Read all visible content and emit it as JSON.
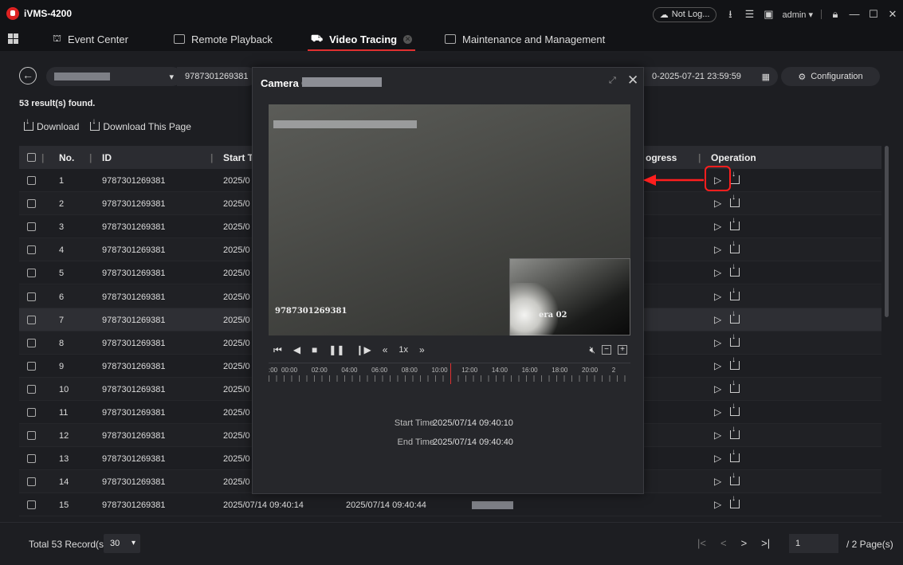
{
  "app": {
    "title": "iVMS-4200"
  },
  "titlebar": {
    "status": "Not Log...",
    "user": "admin"
  },
  "tabs": [
    {
      "label": "Event Center"
    },
    {
      "label": "Remote Playback"
    },
    {
      "label": "Video Tracing",
      "active": true
    },
    {
      "label": "Maintenance and Management"
    }
  ],
  "search": {
    "id_value": "9787301269381",
    "time_range": "0-2025-07-21 23:59:59",
    "config_label": "Configuration"
  },
  "results": {
    "summary": "53 result(s) found."
  },
  "toolbar": {
    "download": "Download",
    "download_page": "Download This Page"
  },
  "table": {
    "headers": {
      "no": "No.",
      "id": "ID",
      "start": "Start T",
      "progress": "ogress",
      "operation": "Operation"
    },
    "rows": [
      {
        "no": "1",
        "id": "9787301269381",
        "start": "2025/0"
      },
      {
        "no": "2",
        "id": "9787301269381",
        "start": "2025/0"
      },
      {
        "no": "3",
        "id": "9787301269381",
        "start": "2025/0"
      },
      {
        "no": "4",
        "id": "9787301269381",
        "start": "2025/0"
      },
      {
        "no": "5",
        "id": "9787301269381",
        "start": "2025/0"
      },
      {
        "no": "6",
        "id": "9787301269381",
        "start": "2025/0"
      },
      {
        "no": "7",
        "id": "9787301269381",
        "start": "2025/0"
      },
      {
        "no": "8",
        "id": "9787301269381",
        "start": "2025/0"
      },
      {
        "no": "9",
        "id": "9787301269381",
        "start": "2025/0"
      },
      {
        "no": "10",
        "id": "9787301269381",
        "start": "2025/0"
      },
      {
        "no": "11",
        "id": "9787301269381",
        "start": "2025/0"
      },
      {
        "no": "12",
        "id": "9787301269381",
        "start": "2025/0"
      },
      {
        "no": "13",
        "id": "9787301269381",
        "start": "2025/0"
      },
      {
        "no": "14",
        "id": "9787301269381",
        "start": "2025/0"
      },
      {
        "no": "15",
        "id": "9787301269381",
        "start": "2025/07/14 09:40:14",
        "end": "2025/07/14 09:40:44"
      }
    ]
  },
  "footer": {
    "total": "Total 53 Record(s)",
    "per_page": "30",
    "page": "1",
    "page_count": "/ 2 Page(s)"
  },
  "dialog": {
    "title": "Camera 01",
    "osd_left": "9787301269381",
    "osd_pip": "era 02",
    "speed": "1x",
    "timeline_labels": [
      ":00",
      "00:00",
      "02:00",
      "04:00",
      "06:00",
      "08:00",
      "10:00",
      "12:00",
      "14:00",
      "16:00",
      "18:00",
      "20:00",
      "2"
    ],
    "start_label": "Start Time",
    "start_value": "2025/07/14 09:40:10",
    "end_label": "End Time",
    "end_value": "2025/07/14 09:40:40"
  },
  "colors": {
    "accent": "#e03030",
    "annotation": "#ff1e1e",
    "background": "#1d1e22"
  }
}
